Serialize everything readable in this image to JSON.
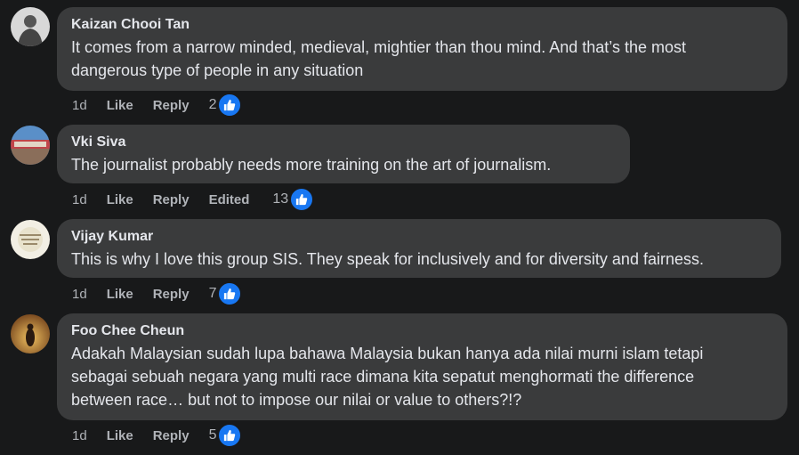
{
  "comments": [
    {
      "author": "Kaizan Chooi Tan",
      "text_lines": [
        "It comes from a narrow minded, medieval, mightier than thou mind. And that’s the most",
        "dangerous type of people in any situation"
      ],
      "time": "1d",
      "like": "Like",
      "reply": "Reply",
      "reactions": "2"
    },
    {
      "author": "Vki Siva",
      "text_lines": [
        "The journalist probably needs more training on the art of journalism."
      ],
      "time": "1d",
      "like": "Like",
      "reply": "Reply",
      "edited": "Edited",
      "reactions": "13"
    },
    {
      "author": "Vijay Kumar",
      "text_lines": [
        "This is why I love this group SIS. They speak for inclusively and for diversity and fairness."
      ],
      "time": "1d",
      "like": "Like",
      "reply": "Reply",
      "reactions": "7"
    },
    {
      "author": "Foo Chee Cheun",
      "text_lines": [
        "Adakah Malaysian sudah lupa bahawa Malaysia bukan hanya ada nilai murni islam tetapi",
        "sebagai sebuah negara yang multi race dimana kita sepatut menghormati the difference",
        "between race… but not to impose our nilai or value to others?!?"
      ],
      "time": "1d",
      "like": "Like",
      "reply": "Reply",
      "reactions": "5"
    }
  ],
  "icons": {
    "reaction": "thumbs-up-icon"
  },
  "colors": {
    "background": "#18191a",
    "bubble": "#3a3b3c",
    "like_blue": "#1877f2",
    "secondary_text": "#b0b3b8"
  }
}
